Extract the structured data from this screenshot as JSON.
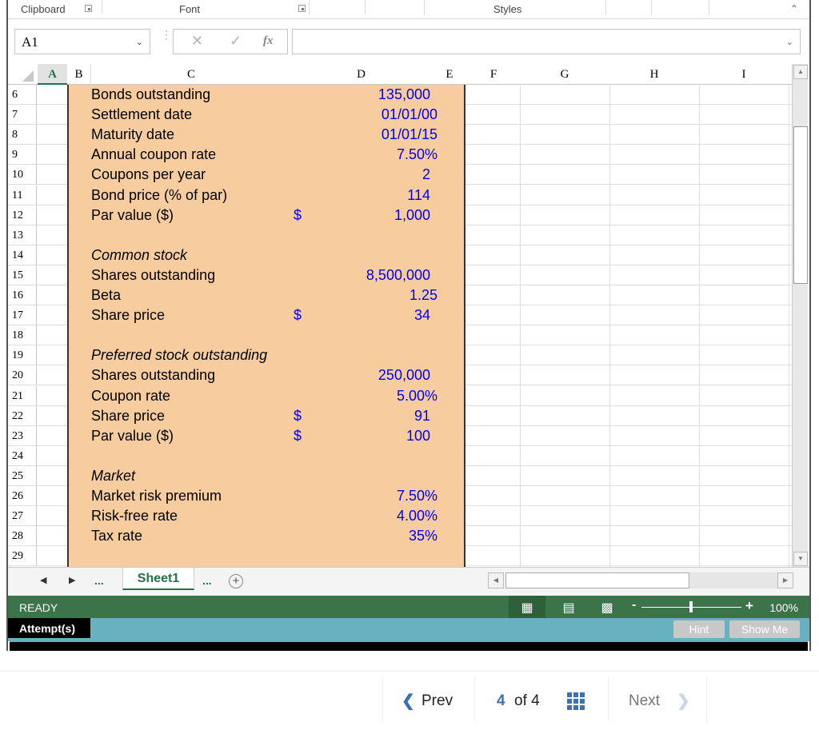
{
  "ribbon": {
    "groups": [
      "Clipboard",
      "Font",
      "Styles"
    ]
  },
  "formula_bar": {
    "name_box": "A1",
    "cancel_icon": "✕",
    "enter_icon": "✓",
    "fx_label": "fx",
    "formula_value": ""
  },
  "columns": [
    "A",
    "B",
    "C",
    "D",
    "E",
    "F",
    "G",
    "H",
    "I"
  ],
  "selected_column": "A",
  "rows": [
    {
      "num": "6",
      "label": "Bonds outstanding",
      "italic": false,
      "dollar": "",
      "value": "135,000"
    },
    {
      "num": "7",
      "label": "Settlement date",
      "italic": false,
      "dollar": "",
      "value": "01/01/00"
    },
    {
      "num": "8",
      "label": "Maturity date",
      "italic": false,
      "dollar": "",
      "value": "01/01/15"
    },
    {
      "num": "9",
      "label": "Annual coupon rate",
      "italic": false,
      "dollar": "",
      "value": "7.50%"
    },
    {
      "num": "10",
      "label": "Coupons per year",
      "italic": false,
      "dollar": "",
      "value": "2"
    },
    {
      "num": "11",
      "label": "Bond price (% of par)",
      "italic": false,
      "dollar": "",
      "value": "114"
    },
    {
      "num": "12",
      "label": "Par value ($)",
      "italic": false,
      "dollar": "$",
      "value": "1,000"
    },
    {
      "num": "13",
      "label": "",
      "italic": false,
      "dollar": "",
      "value": ""
    },
    {
      "num": "14",
      "label": "Common stock",
      "italic": true,
      "dollar": "",
      "value": ""
    },
    {
      "num": "15",
      "label": "Shares outstanding",
      "italic": false,
      "dollar": "",
      "value": "8,500,000"
    },
    {
      "num": "16",
      "label": "Beta",
      "italic": false,
      "dollar": "",
      "value": "1.25"
    },
    {
      "num": "17",
      "label": "Share price",
      "italic": false,
      "dollar": "$",
      "value": "34"
    },
    {
      "num": "18",
      "label": "",
      "italic": false,
      "dollar": "",
      "value": ""
    },
    {
      "num": "19",
      "label": "Preferred stock outstanding",
      "italic": true,
      "dollar": "",
      "value": ""
    },
    {
      "num": "20",
      "label": "Shares outstanding",
      "italic": false,
      "dollar": "",
      "value": "250,000"
    },
    {
      "num": "21",
      "label": "Coupon rate",
      "italic": false,
      "dollar": "",
      "value": "5.00%"
    },
    {
      "num": "22",
      "label": "Share price",
      "italic": false,
      "dollar": "$",
      "value": "91"
    },
    {
      "num": "23",
      "label": "Par value ($)",
      "italic": false,
      "dollar": "$",
      "value": "100"
    },
    {
      "num": "24",
      "label": "",
      "italic": false,
      "dollar": "",
      "value": ""
    },
    {
      "num": "25",
      "label": "Market",
      "italic": true,
      "dollar": "",
      "value": ""
    },
    {
      "num": "26",
      "label": "Market risk premium",
      "italic": false,
      "dollar": "",
      "value": "7.50%"
    },
    {
      "num": "27",
      "label": "Risk-free rate",
      "italic": false,
      "dollar": "",
      "value": "4.00%"
    },
    {
      "num": "28",
      "label": "Tax rate",
      "italic": false,
      "dollar": "",
      "value": "35%"
    },
    {
      "num": "29",
      "label": "",
      "italic": false,
      "dollar": "",
      "value": ""
    }
  ],
  "sheet_tabs": {
    "ellipsis": "...",
    "active_sheet": "Sheet1",
    "add_label": "+"
  },
  "status_bar": {
    "mode": "READY",
    "zoom_minus": "-",
    "zoom_plus": "+",
    "zoom_level": "100%",
    "zoom_fraction": 0.5
  },
  "attempt_bar": {
    "label": "Attempt(s)",
    "hint": "Hint",
    "show_me": "Show Me"
  },
  "pagination": {
    "prev": "Prev",
    "current": "4",
    "of_total": "of 4",
    "next": "Next"
  },
  "colors": {
    "input_fill": "#f7cda0",
    "input_text": "#0000ee",
    "excel_green": "#3b7449",
    "attempt_teal": "#68b1c1",
    "nav_blue": "#3b6fb6"
  }
}
